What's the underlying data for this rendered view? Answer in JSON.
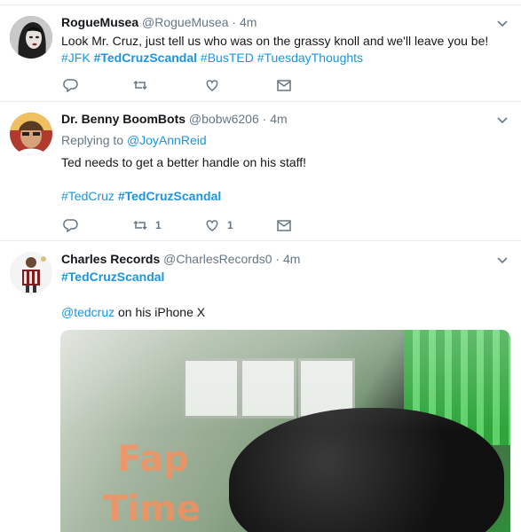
{
  "tweets": [
    {
      "name": "RogueMusea",
      "handle": "@RogueMusea",
      "time": "4m",
      "text": "Look Mr. Cruz, just tell us who was on the grassy knoll and we'll leave you be!",
      "hashtags": [
        "#JFK",
        "#TedCruzScandal",
        "#BusTED",
        "#TuesdayThoughts"
      ],
      "avatar_icon": "avatar-woman",
      "reply_count": "",
      "retweet_count": "",
      "like_count": ""
    },
    {
      "name": "Dr. Benny BoomBots",
      "handle": "@bobw6206",
      "time": "4m",
      "replying_to_label": "Replying to",
      "replying_to": "@JoyAnnReid",
      "text": "Ted needs to get a better handle on his staff!",
      "hashtags": [
        "#TedCruz",
        "#TedCruzScandal"
      ],
      "avatar_icon": "avatar-man",
      "reply_count": "",
      "retweet_count": "1",
      "like_count": "1"
    },
    {
      "name": "Charles Records",
      "handle": "@CharlesRecords0",
      "time": "4m",
      "hashtags": [
        "#TedCruzScandal"
      ],
      "mention": "@tedcruz",
      "text": "on his iPhone X",
      "avatar_icon": "avatar-accordion",
      "media_text_1": "Fap",
      "media_text_2": "Time"
    }
  ],
  "colors": {
    "link": "#1b95e0",
    "muted": "#657786",
    "text": "#14171a",
    "divider": "#e6ecf0"
  },
  "icons": {
    "reply": "reply-icon",
    "retweet": "retweet-icon",
    "like": "heart-icon",
    "dm": "envelope-icon",
    "caret": "chevron-down-icon"
  }
}
